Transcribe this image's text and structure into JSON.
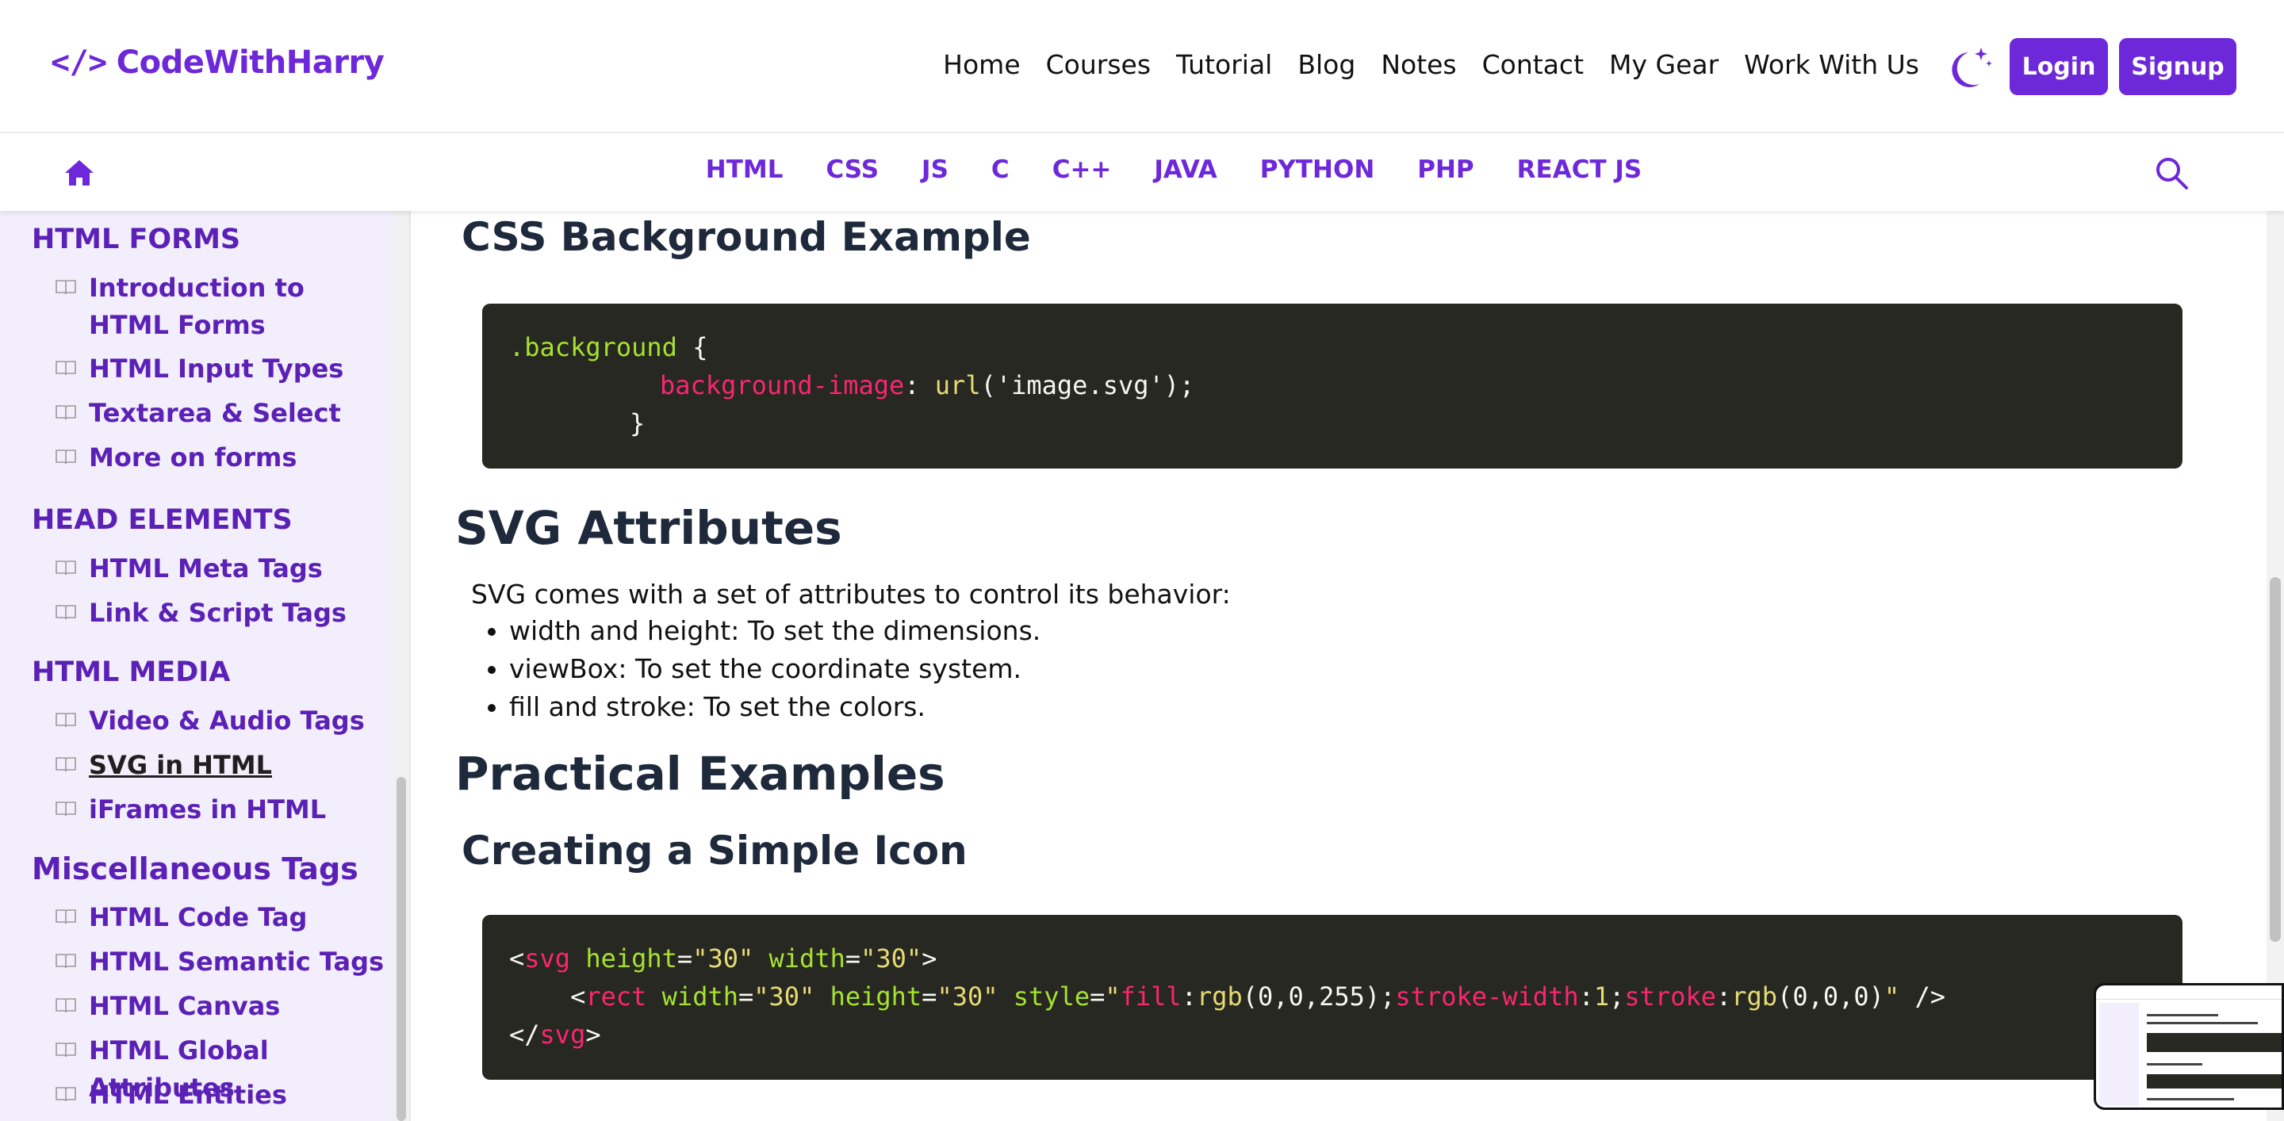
{
  "header": {
    "logo_symbol": "</>",
    "logo_text": "CodeWithHarry",
    "nav": [
      "Home",
      "Courses",
      "Tutorial",
      "Blog",
      "Notes",
      "Contact",
      "My Gear",
      "Work With Us"
    ],
    "login": "Login",
    "signup": "Signup",
    "theme_icon": "moon-stars-icon"
  },
  "subnav": {
    "languages": [
      "HTML",
      "CSS",
      "JS",
      "C",
      "C++",
      "JAVA",
      "PYTHON",
      "PHP",
      "REACT JS"
    ]
  },
  "sidebar": {
    "sections": [
      {
        "title": "HTML FORMS",
        "items": [
          "Introduction to HTML Forms",
          "HTML Input Types",
          "Textarea & Select",
          "More on forms"
        ]
      },
      {
        "title": "HEAD ELEMENTS",
        "items": [
          "HTML Meta Tags",
          "Link & Script Tags"
        ]
      },
      {
        "title": "HTML MEDIA",
        "items": [
          "Video & Audio Tags",
          "SVG in HTML",
          "iFrames in HTML"
        ]
      },
      {
        "title": "Miscellaneous Tags",
        "items": [
          "HTML Code Tag",
          "HTML Semantic Tags",
          "HTML Canvas",
          "HTML Global Attributes",
          "HTML Entities"
        ]
      }
    ],
    "active_item": "SVG in HTML"
  },
  "content": {
    "h_css_bg": "CSS Background Example",
    "code1": {
      "line1_sel": ".background",
      "line1_rest": " {",
      "line2_prop": "background-image",
      "line2_colon": ": ",
      "line2_fn": "url",
      "line2_rest": "('image.svg');",
      "line3": "}"
    },
    "h_svg_attr": "SVG Attributes",
    "svg_intro": "SVG comes with a set of attributes to control its behavior:",
    "svg_list": [
      "width and height: To set the dimensions.",
      "viewBox: To set the coordinate system.",
      "fill and stroke: To set the colors."
    ],
    "h_practical": "Practical Examples",
    "h_simple_icon": "Creating a Simple Icon",
    "code2": {
      "l1": {
        "lt": "<",
        "tag": "svg",
        "sp1": " ",
        "a1": "height",
        "eq1": "=",
        "v1": "\"30\"",
        "sp2": " ",
        "a2": "width",
        "eq2": "=",
        "v2": "\"30\"",
        "gt": ">"
      },
      "l2": {
        "indent": "    ",
        "lt": "<",
        "tag": "rect",
        "sp1": " ",
        "a1": "width",
        "eq1": "=",
        "v1": "\"30\"",
        "sp2": " ",
        "a2": "height",
        "eq2": "=",
        "v2": "\"30\"",
        "sp3": " ",
        "a3": "style",
        "eq3": "=",
        "q1": "\"",
        "p1": "fill",
        "c1": ":",
        "f1": "rgb",
        "r1": "(0,0,255);",
        "p2": "stroke-width",
        "c2": ":",
        "n2": "1",
        "s2": ";",
        "p3": "stroke",
        "c3": ":",
        "f3": "rgb",
        "r3": "(0,0,0)",
        "q2": "\"",
        "end": " />"
      },
      "l3": {
        "lt": "</",
        "tag": "svg",
        "gt": ">"
      }
    }
  },
  "colors": {
    "brand": "#6d28d9",
    "sidebar_bg": "#f3eefc",
    "code_bg": "#272822"
  }
}
